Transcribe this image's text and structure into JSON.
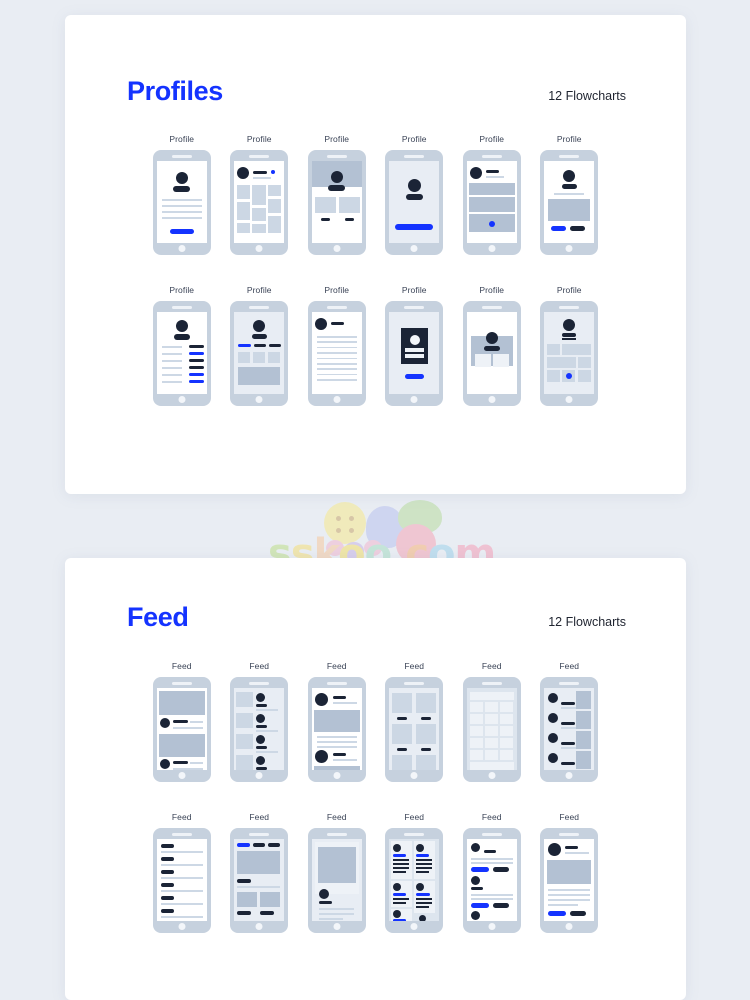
{
  "theme": {
    "background": "#e9edf3",
    "card_background": "#ffffff",
    "accent_blue": "#1433ff",
    "dark_navy": "#1b2436",
    "phone_frame": "#c6d1de",
    "placeholder_gray": "#b9c6d6"
  },
  "watermark": {
    "text": "sskoo.com",
    "letters": [
      "s",
      "s",
      "k",
      "o",
      "o",
      ".",
      "c",
      "o",
      "m"
    ]
  },
  "sections": [
    {
      "id": "profiles",
      "title": "Profiles",
      "count_label": "12 Flowcharts",
      "screens": [
        {
          "label": "Profile",
          "variant": "p1"
        },
        {
          "label": "Profile",
          "variant": "p2"
        },
        {
          "label": "Profile",
          "variant": "p3"
        },
        {
          "label": "Profile",
          "variant": "p4"
        },
        {
          "label": "Profile",
          "variant": "p5"
        },
        {
          "label": "Profile",
          "variant": "p6"
        },
        {
          "label": "Profile",
          "variant": "p7"
        },
        {
          "label": "Profile",
          "variant": "p8"
        },
        {
          "label": "Profile",
          "variant": "p9"
        },
        {
          "label": "Profile",
          "variant": "p10"
        },
        {
          "label": "Profile",
          "variant": "p11"
        },
        {
          "label": "Profile",
          "variant": "p12"
        }
      ]
    },
    {
      "id": "feed",
      "title": "Feed",
      "count_label": "12 Flowcharts",
      "screens": [
        {
          "label": "Feed",
          "variant": "f1"
        },
        {
          "label": "Feed",
          "variant": "f2"
        },
        {
          "label": "Feed",
          "variant": "f3"
        },
        {
          "label": "Feed",
          "variant": "f4"
        },
        {
          "label": "Feed",
          "variant": "f5"
        },
        {
          "label": "Feed",
          "variant": "f6"
        },
        {
          "label": "Feed",
          "variant": "f7"
        },
        {
          "label": "Feed",
          "variant": "f8"
        },
        {
          "label": "Feed",
          "variant": "f9"
        },
        {
          "label": "Feed",
          "variant": "f10"
        },
        {
          "label": "Feed",
          "variant": "f11"
        },
        {
          "label": "Feed",
          "variant": "f12"
        }
      ]
    }
  ]
}
